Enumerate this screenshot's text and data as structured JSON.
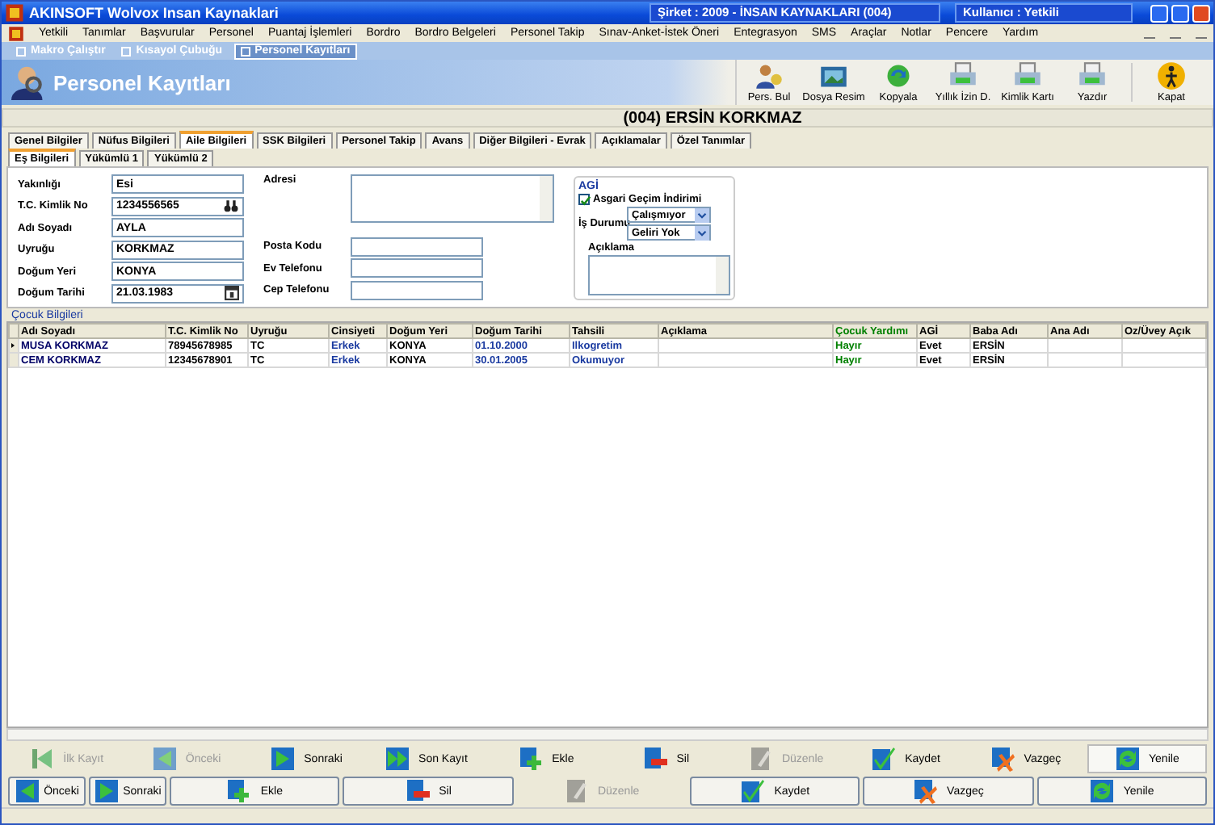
{
  "window": {
    "title": "AKINSOFT Wolvox Insan Kaynaklari",
    "company": "Şirket : 2009 - İNSAN KAYNAKLARI (004)",
    "user": "Kullanıcı : Yetkili"
  },
  "menu": [
    "Yetkili",
    "Tanımlar",
    "Başvurular",
    "Personel",
    "Puantaj İşlemleri",
    "Bordro",
    "Bordro Belgeleri",
    "Personel Takip",
    "Sınav-Anket-İstek Öneri",
    "Entegrasyon",
    "SMS",
    "Araçlar",
    "Notlar",
    "Pencere",
    "Yardım"
  ],
  "doc_tabs": [
    {
      "label": "Makro Çalıştır",
      "selected": false
    },
    {
      "label": "Kısayol Çubuğu",
      "selected": false
    },
    {
      "label": "Personel Kayıtları",
      "selected": true
    }
  ],
  "page_title": "Personel Kayıtları",
  "toolbar": [
    {
      "label": "Pers. Bul",
      "kind": "find"
    },
    {
      "label": "Dosya Resim",
      "kind": "photo"
    },
    {
      "label": "Kopyala",
      "kind": "copy"
    },
    {
      "label": "Yıllık İzin D.",
      "kind": "print"
    },
    {
      "label": "Kimlik Kartı",
      "kind": "print"
    },
    {
      "label": "Yazdır",
      "kind": "print"
    },
    {
      "label": "Kapat",
      "kind": "exit"
    }
  ],
  "record_title": "(004) ERSİN KORKMAZ",
  "tabs": [
    {
      "label": "Genel Bilgiler",
      "selected": false
    },
    {
      "label": "Nüfus Bilgileri",
      "selected": false
    },
    {
      "label": "Aile Bilgileri",
      "selected": true
    },
    {
      "label": "SSK Bilgileri",
      "selected": false
    },
    {
      "label": "Personel Takip",
      "selected": false
    },
    {
      "label": "Avans",
      "selected": false
    },
    {
      "label": "Diğer Bilgileri - Evrak",
      "selected": false
    },
    {
      "label": "Açıklamalar",
      "selected": false
    },
    {
      "label": "Özel Tanımlar",
      "selected": false
    }
  ],
  "sub_tabs": [
    {
      "label": "Eş Bilgileri",
      "selected": true
    },
    {
      "label": "Yükümlü 1",
      "selected": false
    },
    {
      "label": "Yükümlü 2",
      "selected": false
    }
  ],
  "spouse_fields": [
    {
      "label": "Yakınlığı",
      "value": "Esi",
      "kind": "text"
    },
    {
      "label": "T.C. Kimlik No",
      "value": "1234556565",
      "kind": "lookup"
    },
    {
      "label": "Adı Soyadı",
      "value": "AYLA",
      "kind": "text"
    },
    {
      "label": "Uyruğu",
      "value": "KORKMAZ",
      "kind": "text"
    },
    {
      "label": "Doğum Yeri",
      "value": "KONYA",
      "kind": "text"
    },
    {
      "label": "Doğum Tarihi",
      "value": "21.03.1983",
      "kind": "date"
    }
  ],
  "address_label": "Adresi",
  "contact_fields": [
    {
      "label": "Posta Kodu"
    },
    {
      "label": "Ev Telefonu"
    },
    {
      "label": "Cep Telefonu"
    }
  ],
  "agi": {
    "title": "AGİ",
    "checkbox": {
      "label": "Asgari Geçim İndirimi",
      "checked": true
    },
    "status_label": "İş Durumu",
    "selects": [
      "Çalışmıyor",
      "Geliri Yok"
    ],
    "note_label": "Açıklama"
  },
  "children": {
    "title": "Çocuk Bilgileri",
    "columns": [
      {
        "label": "Adı Soyadı",
        "color": "#000000"
      },
      {
        "label": "T.C. Kimlik No",
        "color": "#000000"
      },
      {
        "label": "Uyruğu",
        "color": "#000000"
      },
      {
        "label": "Cinsiyeti",
        "color": "#000000"
      },
      {
        "label": "Doğum Yeri",
        "color": "#000000"
      },
      {
        "label": "Doğum Tarihi",
        "color": "#000000"
      },
      {
        "label": "Tahsili",
        "color": "#000000"
      },
      {
        "label": "Açıklama",
        "color": "#000000"
      },
      {
        "label": "Çocuk Yardımı",
        "color": "#008000"
      },
      {
        "label": "AGİ",
        "color": "#000000"
      },
      {
        "label": "Baba Adı",
        "color": "#000000"
      },
      {
        "label": "Ana Adı",
        "color": "#000000"
      },
      {
        "label": "Oz/Üvey Açık",
        "color": "#000000"
      }
    ],
    "rows": [
      {
        "current": true,
        "cells": [
          "MUSA KORKMAZ",
          "78945678985",
          "TC",
          "Erkek",
          "KONYA",
          "01.10.2000",
          "Ilkogretim",
          "",
          "Hayır",
          "Evet",
          "ERSİN",
          "",
          ""
        ]
      },
      {
        "current": false,
        "cells": [
          "CEM KORKMAZ",
          "12345678901",
          "TC",
          "Erkek",
          "KONYA",
          "30.01.2005",
          "Okumuyor",
          "",
          "Hayır",
          "Evet",
          "ERSİN",
          "",
          ""
        ]
      }
    ]
  },
  "nav_bar": [
    {
      "label": "İlk Kayıt",
      "kind": "first",
      "disabled": true
    },
    {
      "label": "Önceki",
      "kind": "prev",
      "disabled": true
    },
    {
      "label": "Sonraki",
      "kind": "next",
      "disabled": false
    },
    {
      "label": "Son Kayıt",
      "kind": "last",
      "disabled": false
    },
    {
      "label": "Ekle",
      "kind": "add",
      "disabled": false
    },
    {
      "label": "Sil",
      "kind": "delete",
      "disabled": false
    },
    {
      "label": "Düzenle",
      "kind": "edit",
      "disabled": true
    },
    {
      "label": "Kaydet",
      "kind": "save",
      "disabled": false
    },
    {
      "label": "Vazgeç",
      "kind": "cancel",
      "disabled": false
    },
    {
      "label": "Yenile",
      "kind": "refresh",
      "disabled": false
    }
  ],
  "action_bar": [
    {
      "label": "Önceki",
      "kind": "prev",
      "disabled": false
    },
    {
      "label": "Sonraki",
      "kind": "next",
      "disabled": false
    },
    {
      "label": "Ekle",
      "kind": "add",
      "disabled": false
    },
    {
      "label": "Sil",
      "kind": "delete",
      "disabled": false
    },
    {
      "label": "Düzenle",
      "kind": "edit",
      "disabled": true
    },
    {
      "label": "Kaydet",
      "kind": "save",
      "disabled": false
    },
    {
      "label": "Vazgeç",
      "kind": "cancel",
      "disabled": false
    },
    {
      "label": "Yenile",
      "kind": "refresh",
      "disabled": false
    }
  ]
}
